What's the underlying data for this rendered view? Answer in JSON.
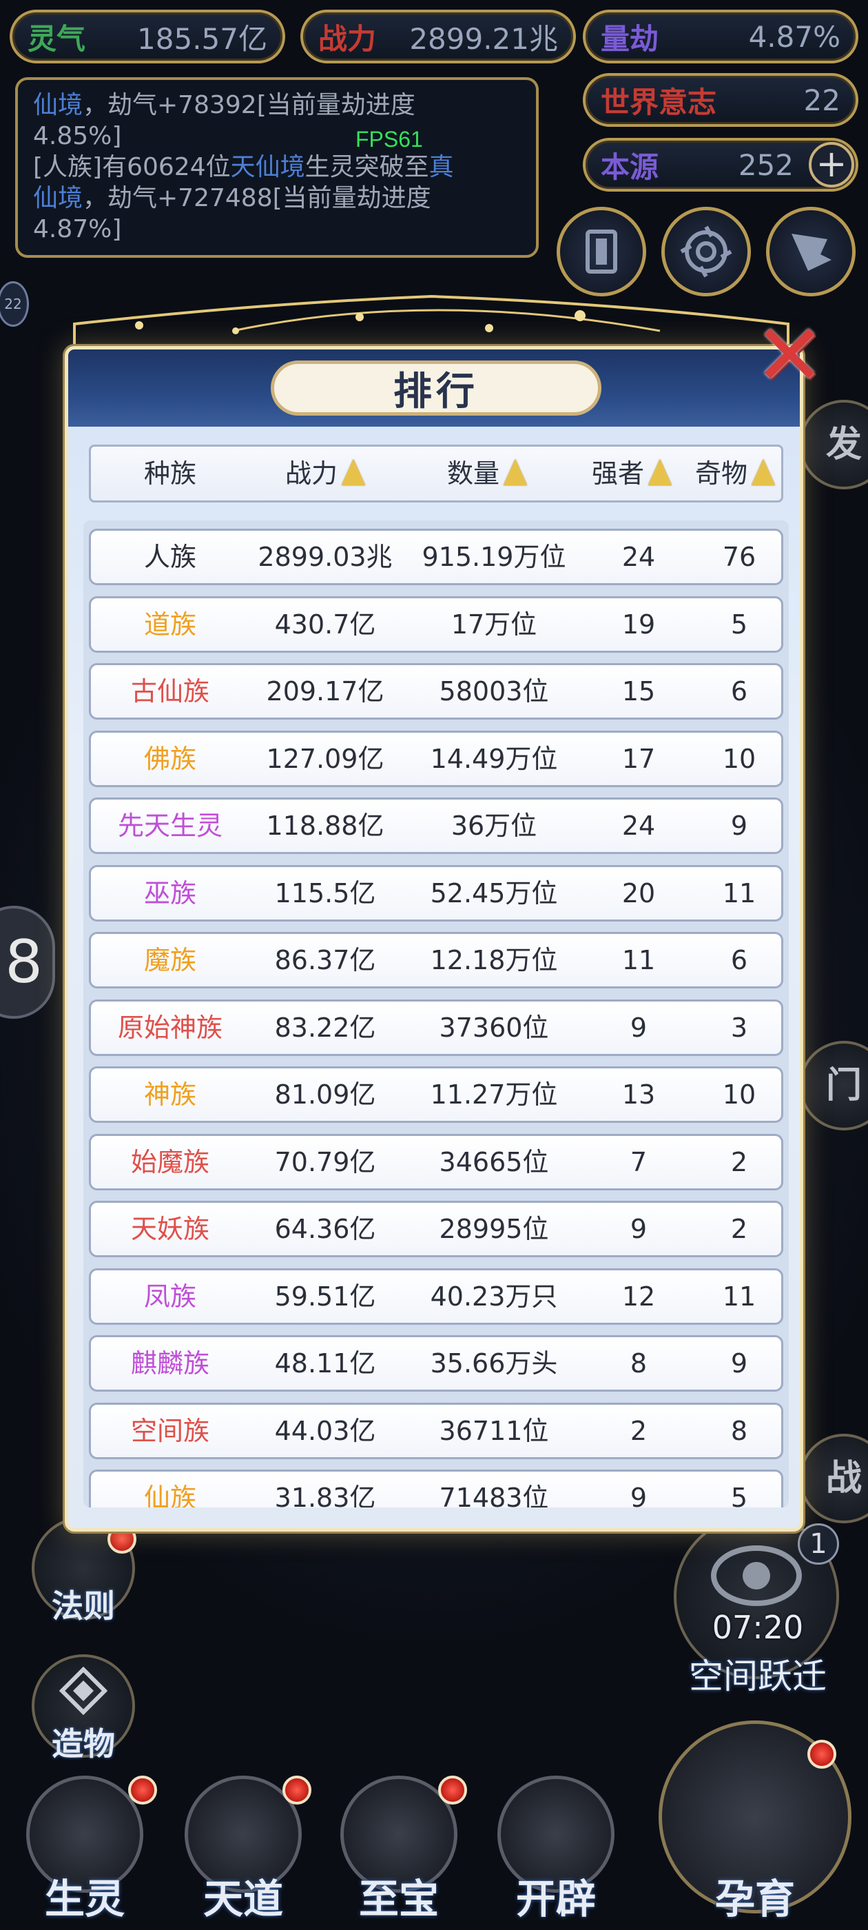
{
  "top_stats": {
    "lingqi": {
      "label": "灵气",
      "value": "185.57亿",
      "label_color": "#3ea857"
    },
    "zhanli": {
      "label": "战力",
      "value": "2899.21兆",
      "label_color": "#c53b33"
    },
    "liangjie": {
      "label": "量劫",
      "value": "4.87%",
      "label_color": "#7a5bd6"
    },
    "shijie": {
      "label": "世界意志",
      "value": "22",
      "label_color": "#c53b33"
    },
    "benyuan": {
      "label": "本源",
      "value": "252",
      "label_color": "#7a5bd6",
      "add_symbol": "+"
    }
  },
  "log": {
    "line1_hl": "仙境",
    "line1_rest": "，劫气+78392[当前量劫进度",
    "line2": "4.85%]",
    "line3_a": "[人族]有60624位",
    "line3_hl": "天仙境",
    "line3_b": "生灵突破至",
    "line3_hl2": "真",
    "line4_hl": "仙境",
    "line4_rest": "，劫气+727488[当前量劫进度",
    "line5": "4.87%]"
  },
  "fps": "FPS61",
  "side": {
    "badge_small": "22",
    "left_eye": "8",
    "right_fa": "发",
    "right_men": "门",
    "right_zhan": "战"
  },
  "panel": {
    "title": "排行",
    "close_symbol": "✕",
    "headers": [
      "种族",
      "战力",
      "数量",
      "强者",
      "奇物"
    ],
    "rows": [
      {
        "race": "人族",
        "color": "#2a2f3a",
        "power": "2899.03兆",
        "count": "915.19万位",
        "elite": "24",
        "items": "76"
      },
      {
        "race": "道族",
        "color": "#f0a020",
        "power": "430.7亿",
        "count": "17万位",
        "elite": "19",
        "items": "5"
      },
      {
        "race": "古仙族",
        "color": "#e0504a",
        "power": "209.17亿",
        "count": "58003位",
        "elite": "15",
        "items": "6"
      },
      {
        "race": "佛族",
        "color": "#f0a020",
        "power": "127.09亿",
        "count": "14.49万位",
        "elite": "17",
        "items": "10"
      },
      {
        "race": "先天生灵",
        "color": "#c04fd8",
        "power": "118.88亿",
        "count": "36万位",
        "elite": "24",
        "items": "9"
      },
      {
        "race": "巫族",
        "color": "#c04fd8",
        "power": "115.5亿",
        "count": "52.45万位",
        "elite": "20",
        "items": "11"
      },
      {
        "race": "魔族",
        "color": "#f0a020",
        "power": "86.37亿",
        "count": "12.18万位",
        "elite": "11",
        "items": "6"
      },
      {
        "race": "原始神族",
        "color": "#e0504a",
        "power": "83.22亿",
        "count": "37360位",
        "elite": "9",
        "items": "3"
      },
      {
        "race": "神族",
        "color": "#f0a020",
        "power": "81.09亿",
        "count": "11.27万位",
        "elite": "13",
        "items": "10"
      },
      {
        "race": "始魔族",
        "color": "#e0504a",
        "power": "70.79亿",
        "count": "34665位",
        "elite": "7",
        "items": "2"
      },
      {
        "race": "天妖族",
        "color": "#e0504a",
        "power": "64.36亿",
        "count": "28995位",
        "elite": "9",
        "items": "2"
      },
      {
        "race": "凤族",
        "color": "#c04fd8",
        "power": "59.51亿",
        "count": "40.23万只",
        "elite": "12",
        "items": "11"
      },
      {
        "race": "麒麟族",
        "color": "#c04fd8",
        "power": "48.11亿",
        "count": "35.66万头",
        "elite": "8",
        "items": "9"
      },
      {
        "race": "空间族",
        "color": "#e0504a",
        "power": "44.03亿",
        "count": "36711位",
        "elite": "2",
        "items": "8"
      },
      {
        "race": "仙族",
        "color": "#f0a020",
        "power": "31.83亿",
        "count": "71483位",
        "elite": "9",
        "items": "5"
      }
    ]
  },
  "left_buttons": {
    "faze": "法则",
    "zaowu": "造物"
  },
  "space_jump": {
    "timer": "07:20",
    "label": "空间跃迁",
    "count": "1"
  },
  "bottom_nav": [
    "生灵",
    "天道",
    "至宝",
    "开辟",
    "孕育"
  ]
}
